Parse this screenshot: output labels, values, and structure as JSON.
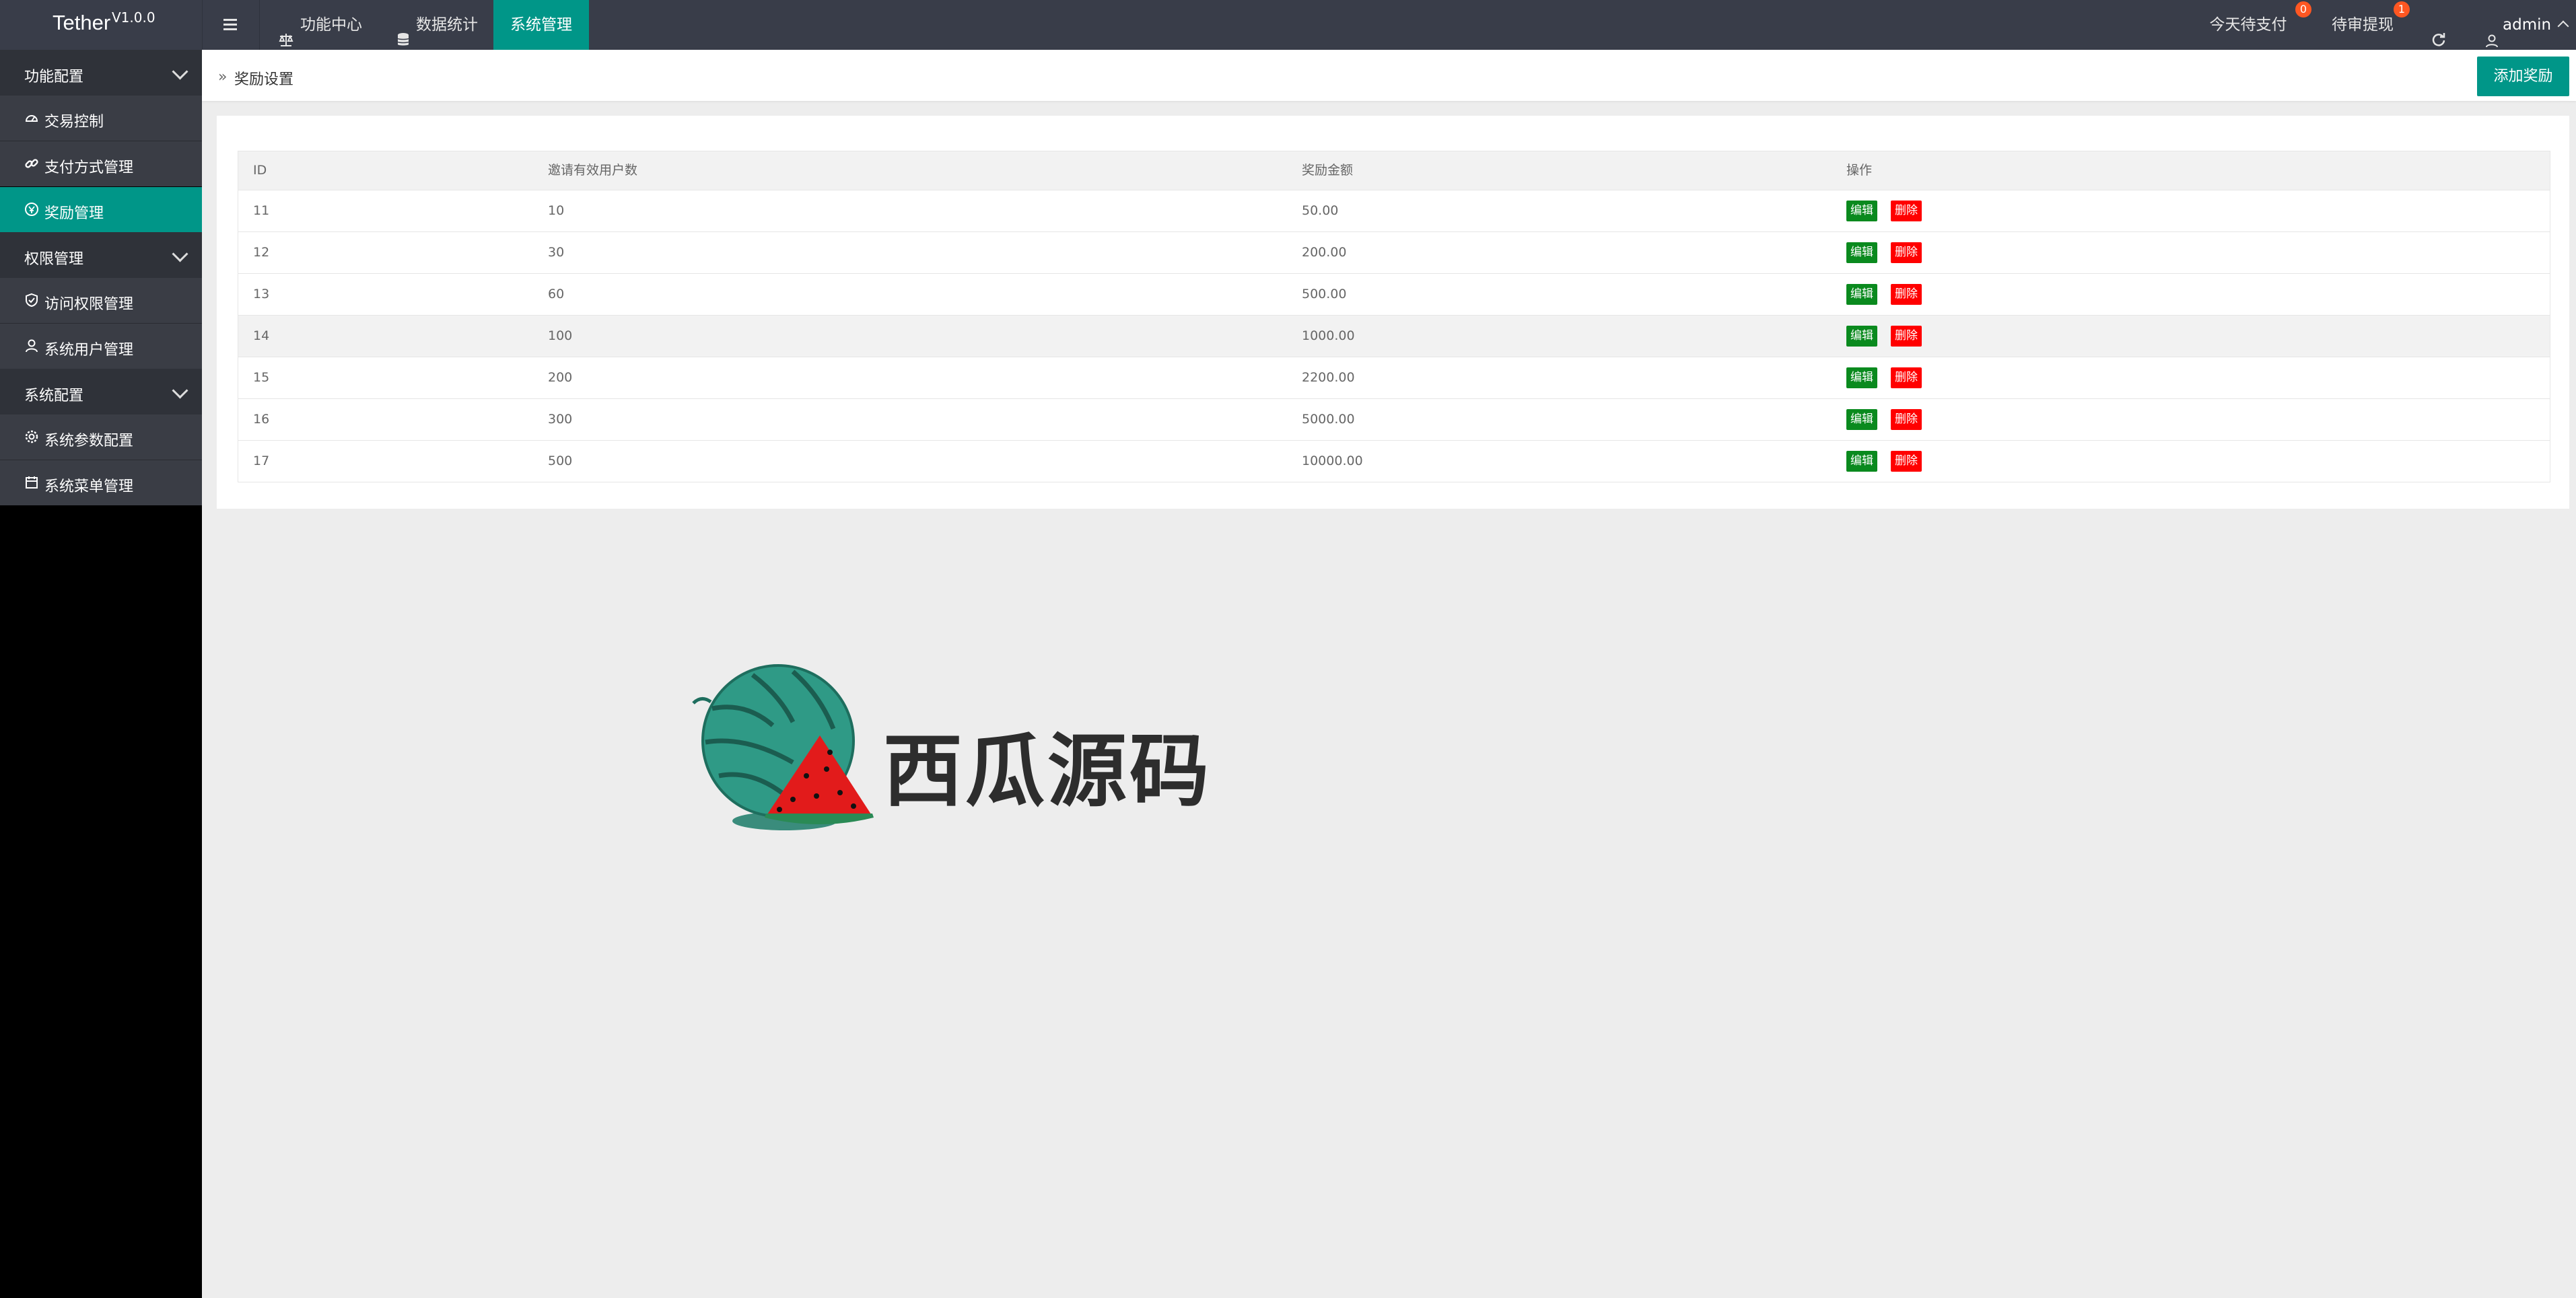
{
  "app": {
    "name": "Tether",
    "version": "V1.0.0"
  },
  "top_nav": {
    "items": [
      {
        "label": "功能中心",
        "icon": "balance-icon"
      },
      {
        "label": "数据统计",
        "icon": "database-icon"
      },
      {
        "label": "系统管理",
        "icon": "",
        "active": true
      }
    ],
    "right": {
      "pending_pay": {
        "label": "今天待支付",
        "count": "0"
      },
      "pending_withdraw": {
        "label": "待审提现",
        "count": "1"
      },
      "user": "admin"
    }
  },
  "sidebar": {
    "groups": [
      {
        "label": "功能配置",
        "items": [
          {
            "label": "交易控制",
            "icon": "dashboard-icon"
          },
          {
            "label": "支付方式管理",
            "icon": "link-icon"
          },
          {
            "label": "奖励管理",
            "icon": "reward-icon",
            "active": true
          }
        ]
      },
      {
        "label": "权限管理",
        "items": [
          {
            "label": "访问权限管理",
            "icon": "shield-check-icon"
          },
          {
            "label": "系统用户管理",
            "icon": "user-icon"
          }
        ]
      },
      {
        "label": "系统配置",
        "items": [
          {
            "label": "系统参数配置",
            "icon": "gear-icon"
          },
          {
            "label": "系统菜单管理",
            "icon": "calendar-icon"
          }
        ]
      }
    ]
  },
  "breadcrumb": {
    "current": "奖励设置"
  },
  "actions": {
    "add_label": "添加奖励"
  },
  "table": {
    "columns": [
      "ID",
      "邀请有效用户数",
      "奖励金额",
      "操作"
    ],
    "row_actions": {
      "edit": "编辑",
      "delete": "删除"
    },
    "rows": [
      {
        "id": "11",
        "users": "10",
        "amount": "50.00"
      },
      {
        "id": "12",
        "users": "30",
        "amount": "200.00"
      },
      {
        "id": "13",
        "users": "60",
        "amount": "500.00"
      },
      {
        "id": "14",
        "users": "100",
        "amount": "1000.00"
      },
      {
        "id": "15",
        "users": "200",
        "amount": "2200.00"
      },
      {
        "id": "16",
        "users": "300",
        "amount": "5000.00"
      },
      {
        "id": "17",
        "users": "500",
        "amount": "10000.00"
      }
    ]
  },
  "watermark": {
    "text": "西瓜源码"
  },
  "colors": {
    "accent": "#009688",
    "topbar": "#393d49",
    "edit": "#0a8a1e",
    "delete": "#ff0000",
    "badge": "#ff5722"
  }
}
